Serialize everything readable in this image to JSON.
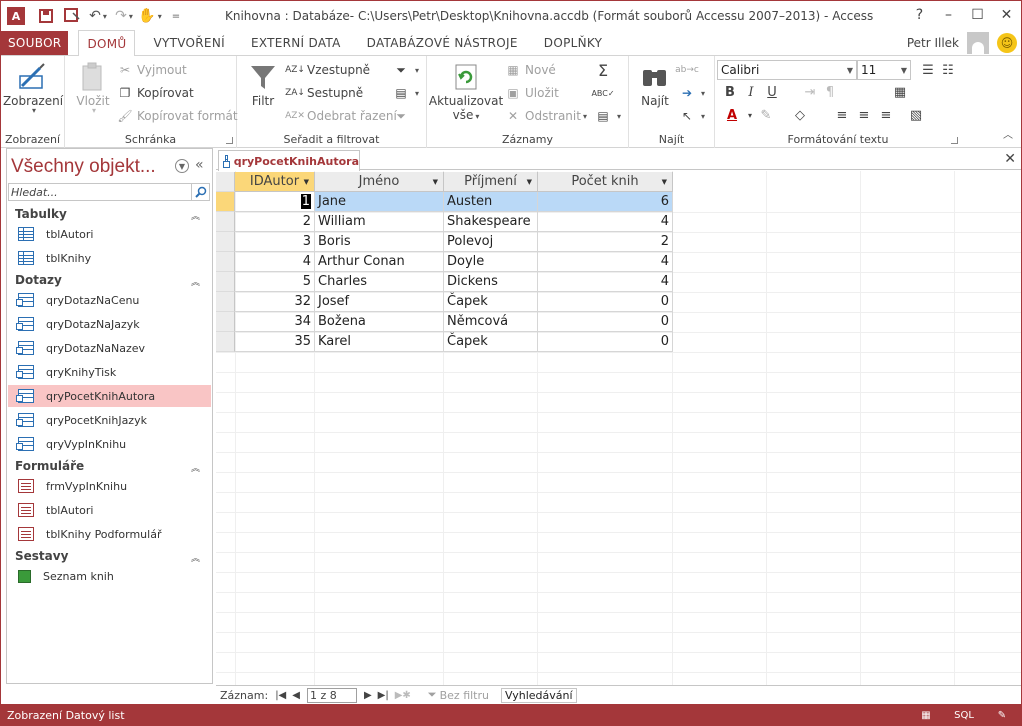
{
  "window": {
    "title": "Knihovna : Databáze- C:\\Users\\Petr\\Desktop\\Knihovna.accdb (Formát souborů Accessu 2007–2013) - Access",
    "app_logo": "A",
    "help": "?",
    "minimize": "–",
    "maximize": "☐",
    "close": "✕"
  },
  "ribbon_tabs": [
    "SOUBOR",
    "DOMŮ",
    "VYTVOŘENÍ",
    "EXTERNÍ DATA",
    "DATABÁZOVÉ NÁSTROJE",
    "DOPLŇKY"
  ],
  "user": {
    "name": "Petr Illek"
  },
  "ribbon": {
    "views": {
      "view_label": "Zobrazení",
      "group": "Zobrazení"
    },
    "clipboard": {
      "paste": "Vložit",
      "cut": "Vyjmout",
      "copy": "Kopírovat",
      "format_painter": "Kopírovat formát",
      "group": "Schránka"
    },
    "sort_filter": {
      "filter": "Filtr",
      "ascending": "Vzestupně",
      "descending": "Sestupně",
      "remove_sort": "Odebrat řazení",
      "group": "Seřadit a filtrovat"
    },
    "records": {
      "refresh_l1": "Aktualizovat",
      "refresh_l2": "vše",
      "new": "Nové",
      "save": "Uložit",
      "delete": "Odstranit",
      "group": "Záznamy"
    },
    "find": {
      "find": "Najít",
      "group": "Najít"
    },
    "text_format": {
      "font": "Calibri",
      "size": "11",
      "bold": "B",
      "italic": "I",
      "underline": "U",
      "font_color": "A",
      "group": "Formátování textu"
    }
  },
  "nav": {
    "title": "Všechny objekt...",
    "search_placeholder": "Hledat...",
    "sections": {
      "tables": {
        "label": "Tabulky",
        "items": [
          "tblAutori",
          "tblKnihy"
        ]
      },
      "queries": {
        "label": "Dotazy",
        "items": [
          "qryDotazNaCenu",
          "qryDotazNaJazyk",
          "qryDotazNaNazev",
          "qryKnihyTisk",
          "qryPocetKnihAutora",
          "qryPocetKnihJazyk",
          "qryVypInKnihu"
        ]
      },
      "forms": {
        "label": "Formuláře",
        "items": [
          "frmVypInKnihu",
          "tblAutori",
          "tblKnihy Podformulář"
        ]
      },
      "reports": {
        "label": "Sestavy",
        "items": [
          "Seznam knih"
        ]
      }
    },
    "selected": "qryPocetKnihAutora"
  },
  "document": {
    "tab_title": "qryPocetKnihAutora",
    "close": "✕",
    "columns": [
      "IDAutor",
      "Jméno",
      "Příjmení",
      "Počet knih"
    ],
    "rows": [
      {
        "id": "1",
        "first": "Jane",
        "last": "Austen",
        "count": "6"
      },
      {
        "id": "2",
        "first": "William",
        "last": "Shakespeare",
        "count": "4"
      },
      {
        "id": "3",
        "first": "Boris",
        "last": "Polevoj",
        "count": "2"
      },
      {
        "id": "4",
        "first": "Arthur Conan",
        "last": "Doyle",
        "count": "4"
      },
      {
        "id": "5",
        "first": "Charles",
        "last": "Dickens",
        "count": "4"
      },
      {
        "id": "32",
        "first": "Josef",
        "last": "Čapek",
        "count": "0"
      },
      {
        "id": "34",
        "first": "Božena",
        "last": "Němcová",
        "count": "0"
      },
      {
        "id": "35",
        "first": "Karel",
        "last": "Čapek",
        "count": "0"
      }
    ]
  },
  "record_nav": {
    "label": "Záznam:",
    "position": "1 z 8",
    "no_filter": "Bez filtru",
    "search": "Vyhledávání"
  },
  "status": {
    "text": "Zobrazení Datový list",
    "sql": "SQL"
  },
  "colors": {
    "accent": "#a4373a",
    "selection_row": "#bad9f7",
    "header_selected": "#fbd779",
    "nav_selected": "#f9c5c5"
  }
}
